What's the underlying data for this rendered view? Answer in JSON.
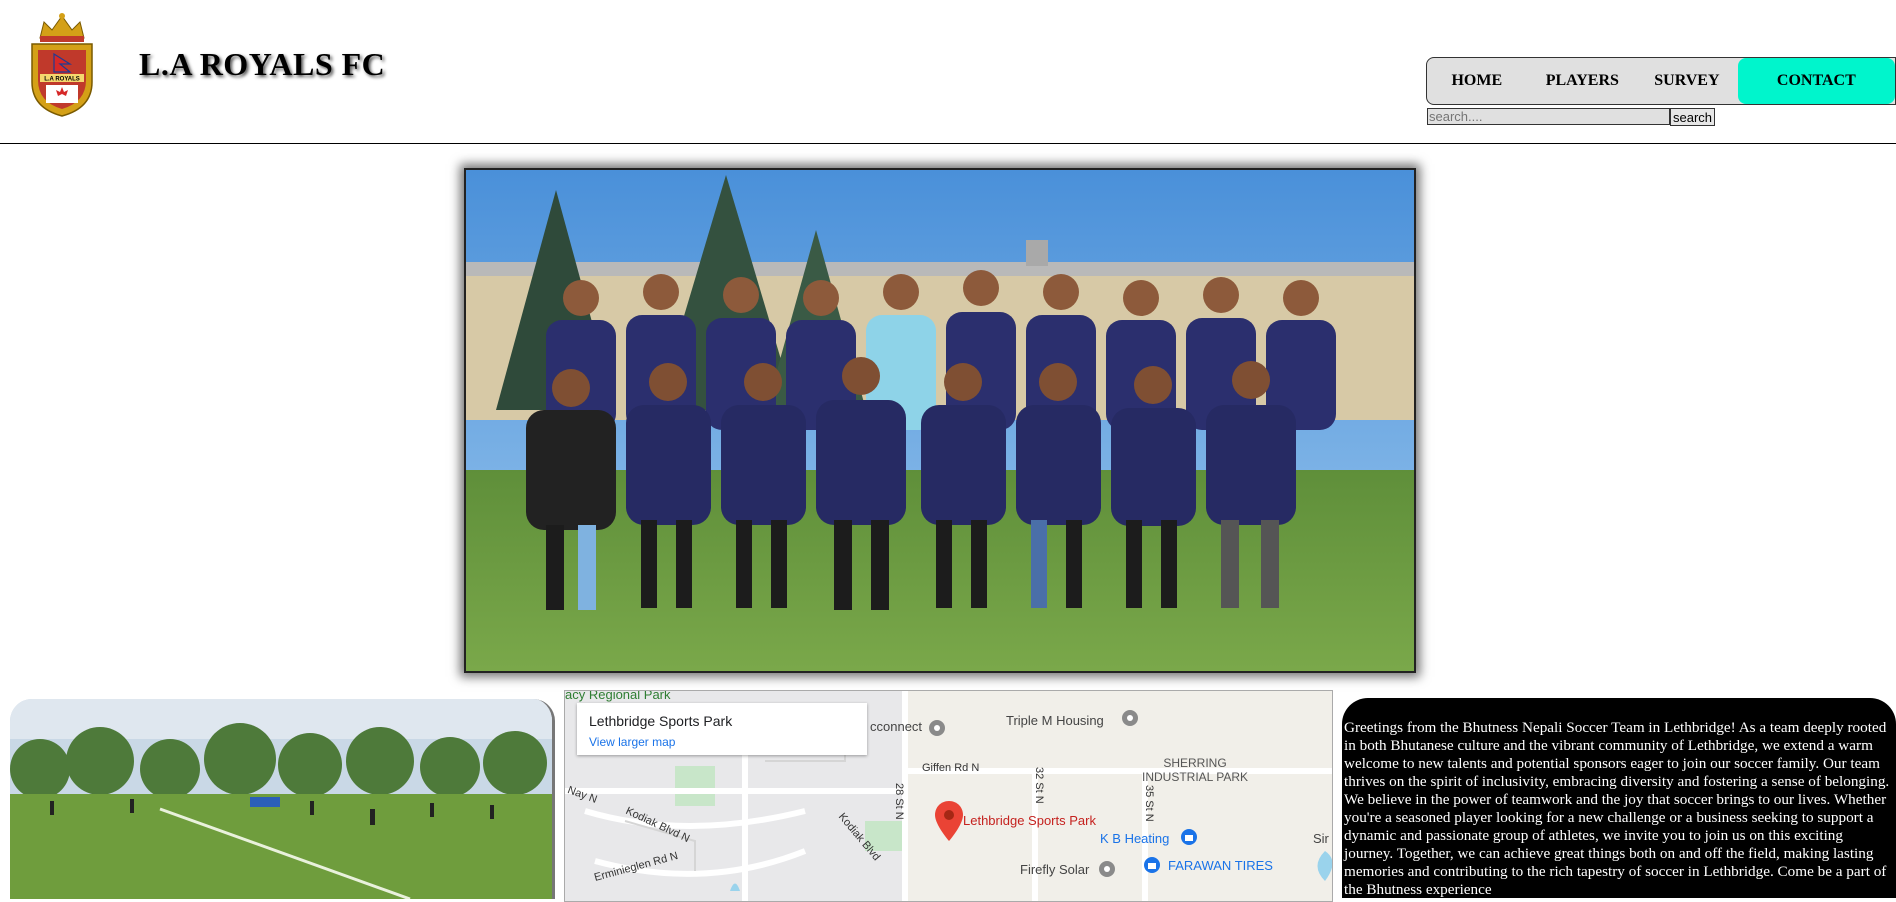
{
  "header": {
    "crest_text": "L.A ROYALS",
    "brand": "L.A ROYALS FC"
  },
  "nav": {
    "items": [
      "HOME",
      "PLAYERS",
      "SURVEY",
      "CONTACT"
    ],
    "active": "CONTACT",
    "active_color": "#00f5cc"
  },
  "search": {
    "placeholder": "search....",
    "button": "search"
  },
  "hero": {
    "image": "team-photo"
  },
  "field": {
    "image": "soccer-field-photo"
  },
  "map": {
    "place_name": "Lethbridge Sports Park",
    "view_link": "View larger map",
    "pin_label": "Lethbridge Sports Park",
    "labels": [
      "acy Regional Park",
      "cconnect",
      "Triple M Housing",
      "SHERRING INDUSTRIAL PARK",
      "K B Heating",
      "FARAWAN TIRES",
      "Firefly Solar",
      "Sir"
    ],
    "roads": [
      "Giffen Rd N",
      "28 St N",
      "32 St N",
      "35 St N",
      "Kodiak Blvd N",
      "Kodiak Blvd",
      "Erminieglen Rd N",
      "Nay N"
    ]
  },
  "about": {
    "text": "Greetings from the Bhutness Nepali Soccer Team in Lethbridge! As a team deeply rooted in both Bhutanese culture and the vibrant community of Lethbridge, we extend a warm welcome to new talents and potential sponsors eager to join our soccer family. Our team thrives on the spirit of inclusivity, embracing diversity and fostering a sense of belonging. We believe in the power of teamwork and the joy that soccer brings to our lives. Whether you're a seasoned player looking for a new challenge or a business seeking to support a dynamic and passionate group of athletes, we invite you to join us on this exciting journey. Together, we can achieve great things both on and off the field, making lasting memories and contributing to the rich tapestry of soccer in Lethbridge. Come be a part of the Bhutness experience"
  }
}
